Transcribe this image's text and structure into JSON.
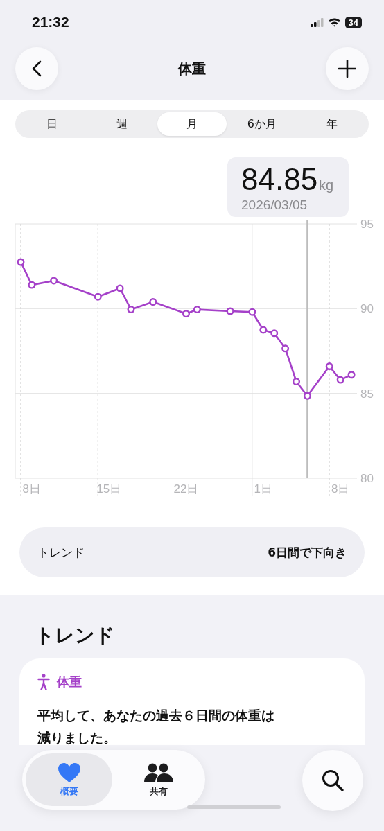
{
  "status_bar": {
    "time": "21:32",
    "battery": "34"
  },
  "nav": {
    "title": "体重"
  },
  "tabs": [
    {
      "label": "日",
      "selected": false
    },
    {
      "label": "週",
      "selected": false
    },
    {
      "label": "月",
      "selected": true
    },
    {
      "label": "6か月",
      "selected": false
    },
    {
      "label": "年",
      "selected": false
    }
  ],
  "selection": {
    "value": "84.85",
    "unit": "kg",
    "date": "2026/03/05"
  },
  "chart": {
    "chart_data": {
      "type": "line",
      "ylim": [
        80,
        95
      ],
      "grid": true,
      "categories": [
        null,
        "8日",
        null,
        null,
        null,
        null,
        null,
        null,
        "15日",
        null,
        null,
        null,
        null,
        null,
        null,
        "22日",
        null,
        null,
        null,
        null,
        null,
        null,
        "1日",
        null,
        null,
        null,
        null,
        null,
        null,
        "8日",
        null
      ],
      "yticks": [
        95,
        90,
        85,
        80
      ],
      "series": [
        {
          "color": "#a541c9",
          "marker": "o",
          "values": [
            92.75,
            91.4,
            null,
            91.65,
            null,
            null,
            null,
            90.7,
            null,
            91.2,
            89.95,
            null,
            90.4,
            null,
            null,
            89.7,
            89.95,
            null,
            null,
            89.85,
            null,
            89.8,
            88.75,
            88.55,
            87.65,
            85.7,
            84.85,
            null,
            86.6,
            85.8,
            86.1
          ]
        }
      ]
    }
  },
  "trend_row": {
    "label": "トレンド",
    "value": "6日間で下向き"
  },
  "trends": {
    "heading": "トレンド",
    "card": {
      "metric": "体重",
      "text": "平均して、あなたの過去６日間の体重は減りました。"
    }
  },
  "tab_bar": [
    {
      "label": "概要",
      "kind": "heart",
      "selected": true
    },
    {
      "label": "共有",
      "kind": "people",
      "selected": false
    }
  ]
}
